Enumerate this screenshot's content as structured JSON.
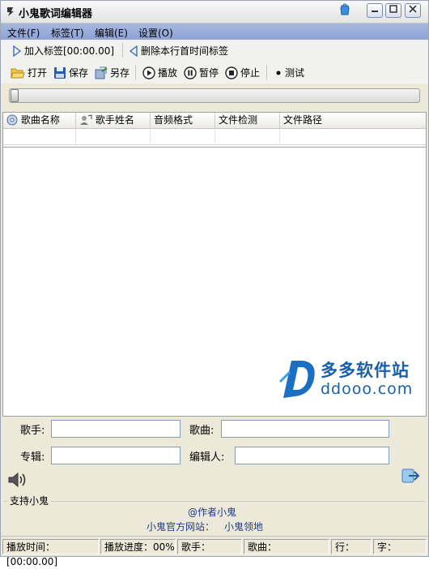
{
  "window": {
    "title": "小鬼歌词编辑器"
  },
  "menu": {
    "items": [
      "文件(F)",
      "标签(T)",
      "编辑(E)",
      "设置(O)"
    ]
  },
  "tagbar": {
    "add_tag": "加入标签[00:00.00]",
    "delete_tag": "删除本行首时间标签"
  },
  "toolbar": {
    "open": "打开",
    "save": "保存",
    "save_as": "另存",
    "play": "播放",
    "pause": "暂停",
    "stop": "停止",
    "test": "测试"
  },
  "progress": {
    "value": 0
  },
  "list": {
    "columns": [
      "歌曲名称",
      "歌手姓名",
      "音频格式",
      "文件检测",
      "文件路径"
    ]
  },
  "watermark": {
    "cn": "多多软件站",
    "en": "ddooo.com"
  },
  "form": {
    "singer_label": "歌手:",
    "song_label": "歌曲:",
    "album_label": "专辑:",
    "editor_label": "编辑人:",
    "singer_value": "",
    "song_value": "",
    "album_value": "",
    "editor_value": ""
  },
  "support": {
    "label": "支持小鬼",
    "author": "@作者小鬼",
    "site_prefix": "小鬼官方网站：",
    "site_name": "小鬼领地"
  },
  "status": {
    "time": "播放时间：[00:00.00]",
    "progress": "播放进度：00%",
    "singer": "歌手：",
    "song": "歌曲：",
    "line": "行：",
    "char": "字："
  },
  "colors": {
    "menubar": "#8da3d6",
    "watermark": "#1a5fa8",
    "link": "#1e3a8a"
  }
}
